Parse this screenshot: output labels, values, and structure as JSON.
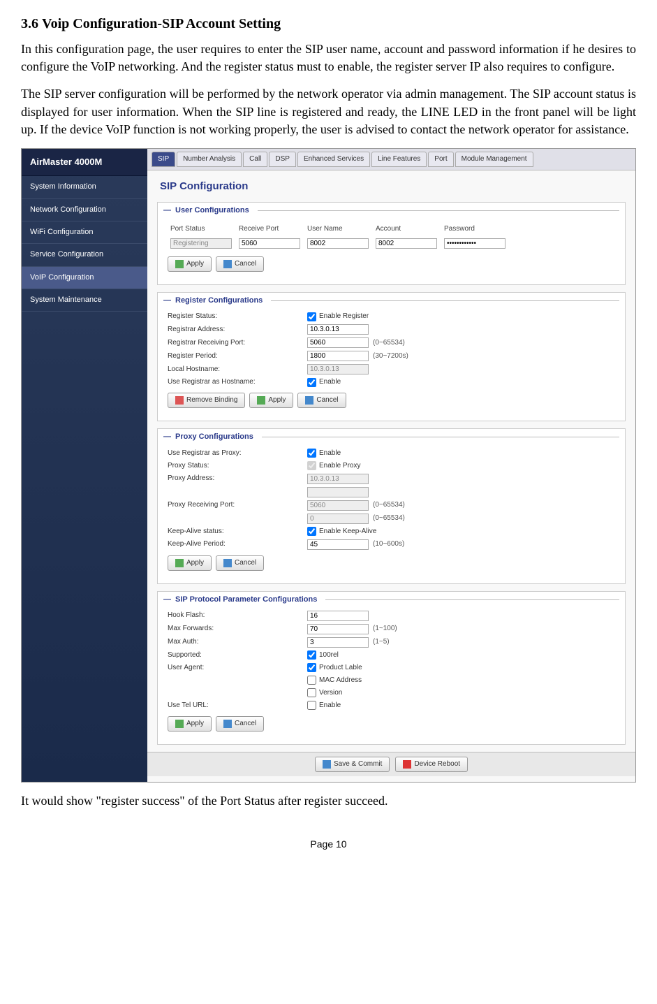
{
  "section_num": "3.6",
  "section_title": "Voip Configuration-SIP Account Setting",
  "para1": "In this configuration page, the user requires to enter the SIP user name, account and password information if he desires to configure the VoIP networking. And the register status must to enable, the register server IP also requires to configure.",
  "para2": "The SIP server configuration will be performed by the network operator via admin management. The SIP account status is displayed for user information. When the SIP line is registered and ready, the LINE LED in the front panel will be light up.  If the device VoIP function is not working properly, the user is advised to contact the network operator for assistance.",
  "para3": "It would show \"register success\" of the Port Status after register succeed.",
  "page_num": "Page 10",
  "brand": "AirMaster 4000M",
  "nav": [
    "System Information",
    "Network Configuration",
    "WiFi Configuration",
    "Service Configuration",
    "VoIP Configuration",
    "System Maintenance"
  ],
  "tabs": [
    "SIP",
    "Number Analysis",
    "Call",
    "DSP",
    "Enhanced Services",
    "Line Features",
    "Port",
    "Module Management"
  ],
  "page_heading": "SIP Configuration",
  "sec_user": "User Configurations",
  "user_cols": [
    "Port Status",
    "Receive Port",
    "User Name",
    "Account",
    "Password"
  ],
  "user_vals": {
    "status": "Registering",
    "port": "5060",
    "user": "8002",
    "acct": "8002",
    "pwd": "••••••••••••"
  },
  "sec_reg": "Register Configurations",
  "reg": {
    "status_lbl": "Register Status:",
    "status_chk": "Enable Register",
    "addr_lbl": "Registrar Address:",
    "addr": "10.3.0.13",
    "rport_lbl": "Registrar Receiving Port:",
    "rport": "5060",
    "rport_hint": "(0~65534)",
    "period_lbl": "Register Period:",
    "period": "1800",
    "period_hint": "(30~7200s)",
    "host_lbl": "Local Hostname:",
    "host": "10.3.0.13",
    "usereg_lbl": "Use Registrar as Hostname:",
    "usereg_chk": "Enable"
  },
  "sec_proxy": "Proxy Configurations",
  "proxy": {
    "usereg_lbl": "Use Registrar as Proxy:",
    "usereg_chk": "Enable",
    "status_lbl": "Proxy Status:",
    "status_chk": "Enable Proxy",
    "addr_lbl": "Proxy Address:",
    "addr": "10.3.0.13",
    "port_lbl": "Proxy Receiving Port:",
    "port1": "5060",
    "port2": "0",
    "port_hint": "(0~65534)",
    "ka_lbl": "Keep-Alive status:",
    "ka_chk": "Enable Keep-Alive",
    "kap_lbl": "Keep-Alive Period:",
    "kap": "45",
    "kap_hint": "(10~600s)"
  },
  "sec_sip": "SIP Protocol Parameter Configurations",
  "sip": {
    "hook_lbl": "Hook Flash:",
    "hook": "16",
    "fwd_lbl": "Max Forwards:",
    "fwd": "70",
    "fwd_hint": "(1~100)",
    "auth_lbl": "Max Auth:",
    "auth": "3",
    "auth_hint": "(1~5)",
    "sup_lbl": "Supported:",
    "sup_chk": "100rel",
    "ua_lbl": "User Agent:",
    "ua1": "Product Lable",
    "ua2": "MAC Address",
    "ua3": "Version",
    "tel_lbl": "Use Tel URL:",
    "tel_chk": "Enable"
  },
  "btns": {
    "apply": "Apply",
    "cancel": "Cancel",
    "remove": "Remove Binding",
    "save": "Save & Commit",
    "reboot": "Device Reboot"
  }
}
